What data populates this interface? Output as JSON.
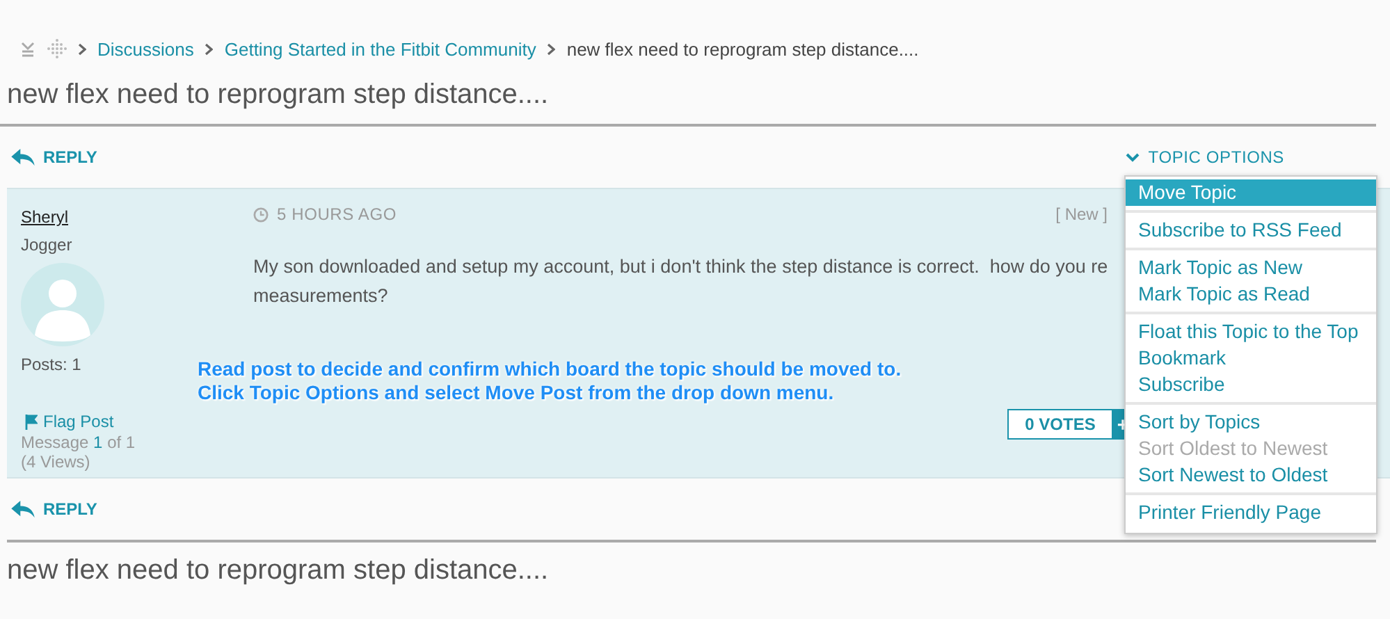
{
  "breadcrumb": [
    {
      "label": "Discussions",
      "kind": "link"
    },
    {
      "label": "Getting Started in the Fitbit Community",
      "kind": "link"
    },
    {
      "label": "new flex need to reprogram step distance....",
      "kind": "current"
    }
  ],
  "topic_title": "new flex need to reprogram step distance....",
  "reply_top": "REPLY",
  "topic_options": "TOPIC OPTIONS",
  "post": {
    "author": "Sheryl",
    "rank": "Jogger",
    "posts": "Posts: 1",
    "time": "5 HOURS AGO",
    "status": "[ New ]",
    "body": [
      "My son downloaded and setup my account, but i don't think the step distance is correct.  how do you re",
      "measurements?"
    ],
    "flag": "Flag Post",
    "message_label": "Message",
    "message_number": "1",
    "message_total": "of 1",
    "views": "(4 Views)",
    "votes": "0 VOTES",
    "vote_plus": "+"
  },
  "annotation": [
    "Read post to decide and confirm which board the topic should be moved to.",
    "Click Topic Options and select Move Post from the drop down menu."
  ],
  "reply_bottom": "REPLY",
  "footer_title": "new flex need to reprogram step distance....",
  "menu": {
    "groups": [
      [
        {
          "label": "Move Topic",
          "selected": true,
          "disabled": false
        }
      ],
      [
        {
          "label": "Subscribe to RSS Feed",
          "selected": false,
          "disabled": false
        }
      ],
      [
        {
          "label": "Mark Topic as New",
          "selected": false,
          "disabled": false
        },
        {
          "label": "Mark Topic as Read",
          "selected": false,
          "disabled": false
        }
      ],
      [
        {
          "label": "Float this Topic to the Top",
          "selected": false,
          "disabled": false
        },
        {
          "label": "Bookmark",
          "selected": false,
          "disabled": false
        },
        {
          "label": "Subscribe",
          "selected": false,
          "disabled": false
        }
      ],
      [
        {
          "label": "Sort by Topics",
          "selected": false,
          "disabled": false
        },
        {
          "label": "Sort Oldest to Newest",
          "selected": false,
          "disabled": true
        },
        {
          "label": "Sort Newest to Oldest",
          "selected": false,
          "disabled": false
        }
      ],
      [
        {
          "label": "Printer Friendly Page",
          "selected": false,
          "disabled": false
        }
      ]
    ]
  }
}
